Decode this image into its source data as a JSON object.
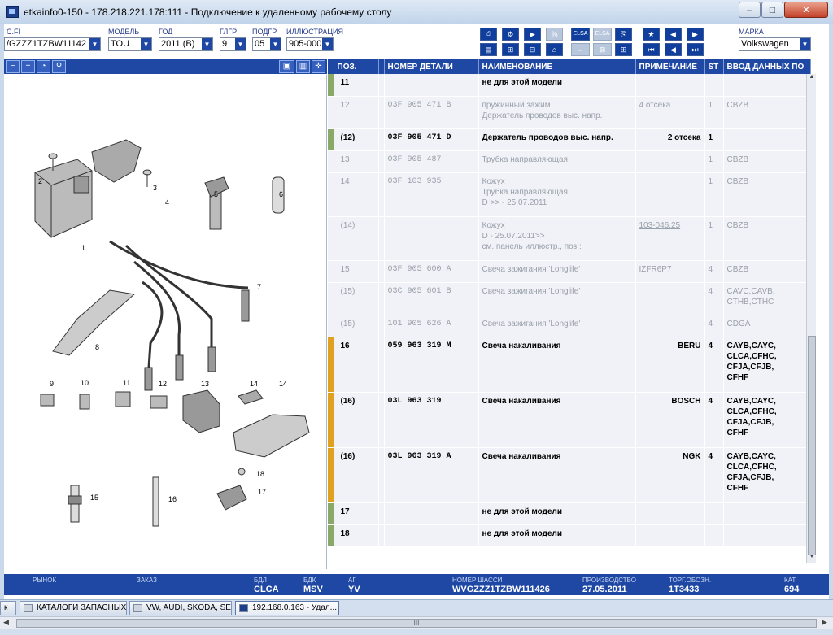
{
  "window": {
    "title": "etkainfo0-150 - 178.218.221.178:111 - Подключение к удаленному рабочему столу",
    "min_label": "–",
    "max_label": "□",
    "close_label": "✕"
  },
  "fields": {
    "vin": {
      "label": "C.FI",
      "value": "/GZZZ1TZBW11142"
    },
    "model": {
      "label": "МОДЕЛЬ",
      "value": "TOU"
    },
    "year": {
      "label": "ГОД",
      "value": "2011 (B)"
    },
    "glgr": {
      "label": "ГЛГР",
      "value": "9"
    },
    "podgr": {
      "label": "ПОДГР",
      "value": "05"
    },
    "illus": {
      "label": "ИЛЛЮСТРАЦИЯ",
      "value": "905-000"
    },
    "brand": {
      "label": "МАРКА",
      "value": "Volkswagen"
    }
  },
  "toolbar_labels": {
    "elsa": "ELSA",
    "elsa2": "ELSA",
    "b1": "⎙",
    "b2": "⚙",
    "b3": "▶",
    "b4": "%",
    "b5": "⎘",
    "b6": "▤",
    "b7": "⊞",
    "b8": "⊟",
    "b9": "⌂",
    "b10": "⇔",
    "b11": "⊠",
    "b12": "⊞",
    "b13": "★",
    "b14": "◀",
    "b15": "▶",
    "b16": "⏮",
    "b17": "◀",
    "b18": "⏭"
  },
  "left_toolbar": {
    "zoom_out": "−",
    "zoom_in": "+",
    "zoom_fit": "◔",
    "search": "⚲",
    "view1": "▣",
    "view2": "▥",
    "move": "✛"
  },
  "table": {
    "headers": [
      "ПОЗ.",
      "НОМЕР ДЕТАЛИ",
      "НАИМЕНОВАНИЕ",
      "ПРИМЕЧАНИЕ",
      "ST",
      "ВВОД ДАННЫХ ПО"
    ],
    "rows": [
      {
        "pos": "11",
        "pn": "",
        "name": "не для этой модели",
        "note": "",
        "st": "",
        "data": "",
        "style": "bold",
        "mark": "#8aa868"
      },
      {
        "pos": "12",
        "pn": "03F 905 471 B",
        "name": "пружинный зажим\nДержатель проводов выс. напр.",
        "note": "4 отсека",
        "st": "1",
        "data": "CBZB",
        "style": "grey",
        "mark": ""
      },
      {
        "pos": "(12)",
        "pn": "03F 905 471 D",
        "name": "Держатель проводов выс. напр.",
        "note": "2 отсека",
        "st": "1",
        "data": "",
        "style": "bold",
        "mark": "#8aa868"
      },
      {
        "pos": "13",
        "pn": "03F 905 487",
        "name": "Трубка направляющая",
        "note": "",
        "st": "1",
        "data": "CBZB",
        "style": "grey",
        "mark": ""
      },
      {
        "pos": "14",
        "pn": "03F 103 935",
        "name": "Кожух\nТрубка направляющая\nD            >> - 25.07.2011",
        "note": "",
        "st": "1",
        "data": "CBZB",
        "style": "grey",
        "mark": ""
      },
      {
        "pos": "(14)",
        "pn": "",
        "name": "Кожух\nD - 25.07.2011>>\n              см. панель иллюстр., поз.:",
        "note": "103-046.25",
        "st": "1",
        "data": "CBZB",
        "style": "grey",
        "mark": ""
      },
      {
        "pos": "15",
        "pn": "03F 905 600 A",
        "name": "Свеча зажигания 'Longlife'",
        "note": "IZFR6P7",
        "st": "4",
        "data": "CBZB",
        "style": "grey",
        "mark": ""
      },
      {
        "pos": "(15)",
        "pn": "03C 905 601 B",
        "name": "Свеча зажигания 'Longlife'",
        "note": "",
        "st": "4",
        "data": "CAVC,CAVB,\nCTHB,CTHC",
        "style": "grey",
        "mark": ""
      },
      {
        "pos": "(15)",
        "pn": "101 905 626 A",
        "name": "Свеча зажигания 'Longlife'",
        "note": "",
        "st": "4",
        "data": "CDGA",
        "style": "grey",
        "mark": ""
      },
      {
        "pos": "16",
        "pn": "059 963 319 M",
        "name": "Свеча накаливания",
        "note": "BERU",
        "st": "4",
        "data": "CAYB,CAYC,\nCLCA,CFHC,\nCFJA,CFJB,\nCFHF",
        "style": "bold",
        "mark": "#e0a020"
      },
      {
        "pos": "(16)",
        "pn": "03L 963 319",
        "name": "Свеча накаливания",
        "note": "BOSCH",
        "st": "4",
        "data": "CAYB,CAYC,\nCLCA,CFHC,\nCFJA,CFJB,\nCFHF",
        "style": "bold",
        "mark": "#e0a020"
      },
      {
        "pos": "(16)",
        "pn": "03L 963 319 A",
        "name": "Свеча накаливания",
        "note": "NGK",
        "st": "4",
        "data": "CAYB,CAYC,\nCLCA,CFHC,\nCFJA,CFJB,\nCFHF",
        "style": "bold",
        "mark": "#e0a020"
      },
      {
        "pos": "17",
        "pn": "",
        "name": "не для этой модели",
        "note": "",
        "st": "",
        "data": "",
        "style": "bold",
        "mark": "#8aa868"
      },
      {
        "pos": "18",
        "pn": "",
        "name": "не для этой модели",
        "note": "",
        "st": "",
        "data": "",
        "style": "bold",
        "mark": "#8aa868"
      }
    ]
  },
  "illustration_labels": [
    "1",
    "2",
    "3",
    "4",
    "5",
    "6",
    "7",
    "8",
    "9",
    "10",
    "11",
    "12",
    "13",
    "14",
    "14",
    "15",
    "16",
    "17",
    "18"
  ],
  "status": {
    "market": {
      "label": "РЫНОК",
      "value": ""
    },
    "order": {
      "label": "ЗАКАЗ",
      "value": ""
    },
    "engine": {
      "label": "БДЛ",
      "value": "CLCA"
    },
    "gearbox": {
      "label": "БДК",
      "value": "MSV"
    },
    "ag": {
      "label": "АГ",
      "value": "YV"
    },
    "chassis": {
      "label": "НОМЕР ШАССИ",
      "value": "WVGZZZ1TZBW111426"
    },
    "produced": {
      "label": "ПРОИЗВОДСТВО",
      "value": "27.05.2011"
    },
    "trade": {
      "label": "ТОРГ.ОБОЗН.",
      "value": "1T3433"
    },
    "cat": {
      "label": "КАТ",
      "value": "694"
    }
  },
  "taskbar": {
    "item0": "к",
    "item1": "КАТАЛОГИ ЗАПАСНЫХ ...",
    "item2": "VW, AUDI, SKODA, SEAT",
    "item3": "192.168.0.163 - Удал...",
    "bottom_mid": "III"
  },
  "colors": {
    "accent": "#1f48a4",
    "mark_green": "#8aa868",
    "mark_orange": "#e0a020"
  }
}
